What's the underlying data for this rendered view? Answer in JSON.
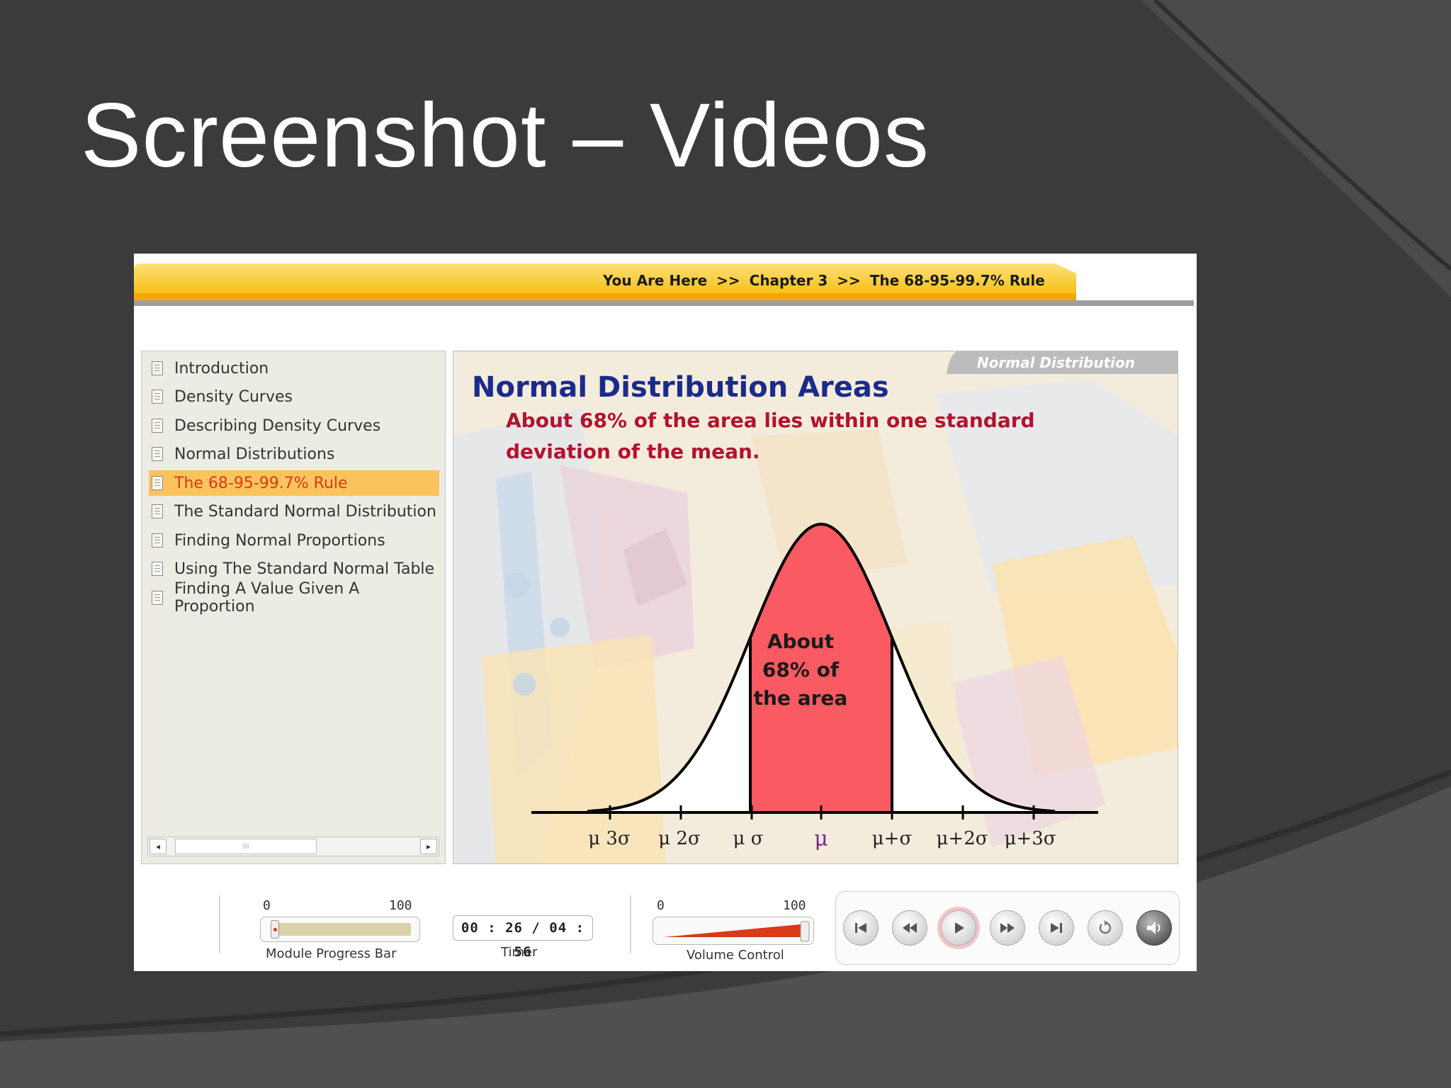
{
  "slide": {
    "title": "Screenshot – Videos"
  },
  "breadcrumb": {
    "prefix": "You Are Here",
    "separator": ">>",
    "chapter": "Chapter 3",
    "current": "The 68-95-99.7% Rule"
  },
  "sidebar": {
    "items": [
      {
        "label": "Introduction",
        "active": false
      },
      {
        "label": "Density Curves",
        "active": false
      },
      {
        "label": "Describing Density Curves",
        "active": false
      },
      {
        "label": "Normal Distributions",
        "active": false
      },
      {
        "label": "The 68-95-99.7% Rule",
        "active": true
      },
      {
        "label": "The Standard Normal Distribution",
        "active": false
      },
      {
        "label": "Finding Normal Proportions",
        "active": false
      },
      {
        "label": "Using The Standard Normal Table",
        "active": false
      },
      {
        "label": "Finding A Value Given A Proportion",
        "active": false
      }
    ],
    "scrollbar": {
      "left_arrow": "◂",
      "right_arrow": "▸",
      "grip": "III"
    }
  },
  "content": {
    "topic_tab": "Normal Distribution",
    "heading": "Normal Distribution Areas",
    "subtext": "About 68% of the area lies within one standard deviation of the mean.",
    "area_label": {
      "line1": "About",
      "line2": "68% of",
      "line3": "the area"
    },
    "tick_labels": [
      "μ 3σ",
      "μ 2σ",
      "μ σ",
      "μ",
      "μ+σ",
      "μ+2σ",
      "μ+3σ"
    ],
    "colors": {
      "heading": "#1b2b8a",
      "subtext": "#b3122e",
      "shaded_area": "#fa5a62"
    }
  },
  "controls": {
    "progress": {
      "min_label": "0",
      "max_label": "100",
      "caption": "Module Progress Bar",
      "value_percent": 3
    },
    "timer": {
      "value": "00 : 26 / 04 : 56",
      "caption": "Timer"
    },
    "volume": {
      "min_label": "0",
      "max_label": "100",
      "caption": "Volume Control",
      "value_percent": 100
    },
    "buttons": [
      "skip-to-start-icon",
      "rewind-icon",
      "play-icon",
      "fast-forward-icon",
      "skip-to-end-icon",
      "replay-icon",
      "speaker-icon"
    ]
  }
}
